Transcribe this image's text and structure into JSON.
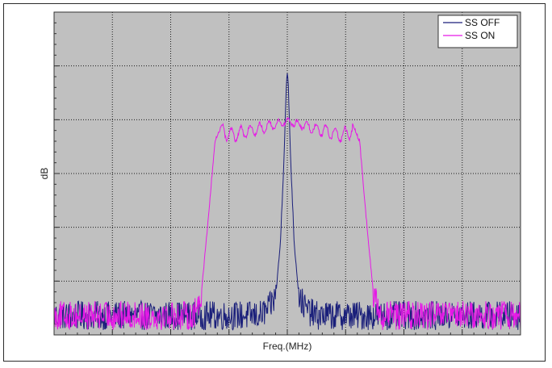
{
  "chart_data": {
    "type": "line",
    "title": "",
    "xlabel": "Freq.(MHz)",
    "ylabel": "dB",
    "xlim": [
      0,
      100
    ],
    "ylim": [
      0,
      100
    ],
    "x_ticks": [
      0,
      12.5,
      25,
      37.5,
      50,
      62.5,
      75,
      87.5,
      100
    ],
    "y_ticks": [
      0,
      16.67,
      33.33,
      50,
      66.67,
      83.33,
      100
    ],
    "grid": true,
    "legend_position": "top-right",
    "background": "#c0c0c0",
    "series": [
      {
        "name": "SS OFF",
        "color": "#1a1f7a",
        "profile": [
          [
            0,
            6
          ],
          [
            44,
            6
          ],
          [
            46,
            8
          ],
          [
            47.5,
            12
          ],
          [
            48.5,
            28
          ],
          [
            49.3,
            55
          ],
          [
            49.8,
            78
          ],
          [
            50,
            81
          ],
          [
            50.2,
            78
          ],
          [
            50.7,
            55
          ],
          [
            51.5,
            28
          ],
          [
            52.5,
            12
          ],
          [
            54,
            8
          ],
          [
            56,
            6
          ],
          [
            100,
            6
          ]
        ],
        "noise_amplitude": 4.5
      },
      {
        "name": "SS ON",
        "color": "#e619e6",
        "profile": [
          [
            0,
            6
          ],
          [
            30,
            6
          ],
          [
            31.5,
            12
          ],
          [
            33,
            35
          ],
          [
            34.5,
            60
          ],
          [
            36.2,
            66
          ],
          [
            38,
            64
          ],
          [
            50,
            67
          ],
          [
            62,
            64
          ],
          [
            63.8,
            66
          ],
          [
            65.5,
            60
          ],
          [
            67,
            35
          ],
          [
            68.5,
            12
          ],
          [
            70,
            6
          ],
          [
            100,
            6
          ]
        ],
        "noise_amplitude": 4.5,
        "ripple_region": [
          36,
          64
        ],
        "ripple_amplitude": 5
      }
    ]
  }
}
